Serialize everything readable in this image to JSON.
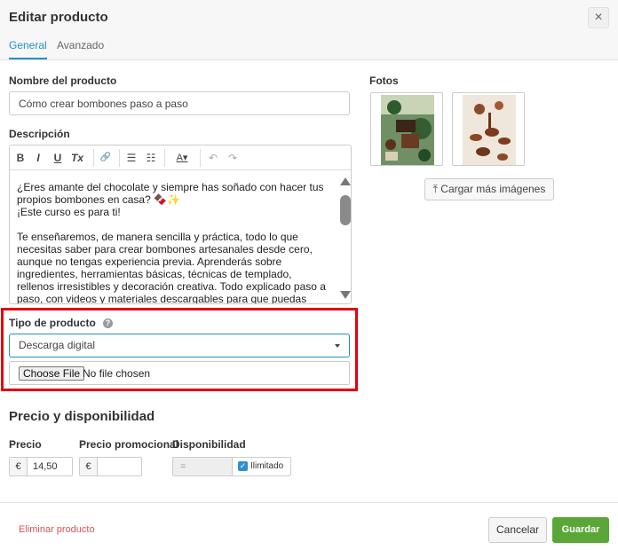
{
  "header": {
    "title": "Editar producto",
    "close": "×",
    "tabs": [
      {
        "label": "General",
        "active": true
      },
      {
        "label": "Avanzado",
        "active": false
      }
    ]
  },
  "form": {
    "name_label": "Nombre del producto",
    "name_value": "Cómo crear bombones paso a paso",
    "description_label": "Descripción",
    "description_text": "¿Eres amante del chocolate y siempre has soñado con hacer tus propios bombones en casa? 🍫✨\n¡Este curso es para ti!\n\nTe enseñaremos, de manera sencilla y práctica, todo lo que necesitas saber para crear bombones artesanales desde cero, aunque no tengas experiencia previa. Aprenderás sobre ingredientes, herramientas básicas, técnicas de templado, rellenos irresistibles y decoración creativa. Todo explicado paso a paso, con videos y materiales descargables para que puedas seguir a tu ritmo.",
    "toolbar": {
      "bold": "B",
      "italic": "I",
      "underline": "U",
      "clear_format": "Tx",
      "link": "🔗",
      "bullet_list": "☰",
      "numbered_list": "☷",
      "text_color": "A▾",
      "undo": "↶",
      "redo": "↷"
    },
    "product_type_label": "Tipo de producto",
    "help": "?",
    "product_type_value": "Descarga digital",
    "file_button": "Choose File",
    "file_status": "No file chosen"
  },
  "photos": {
    "label": "Fotos",
    "upload_button": "Cargar más imágenes"
  },
  "pricing": {
    "section_title": "Precio y disponibilidad",
    "price_label": "Precio",
    "promo_label": "Precio promocional",
    "availability_label": "Disponibilidad",
    "currency": "€",
    "price_value": "14,50",
    "promo_value": "",
    "quantity_placeholder": "=",
    "unlimited_label": "Ilimitado",
    "unlimited_checked": true
  },
  "footer": {
    "delete": "Eliminar producto",
    "cancel": "Cancelar",
    "save": "Guardar"
  },
  "colors": {
    "accent": "#1e90c8",
    "save": "#5aa636",
    "danger": "#d9534f",
    "highlight": "#e3000f"
  }
}
